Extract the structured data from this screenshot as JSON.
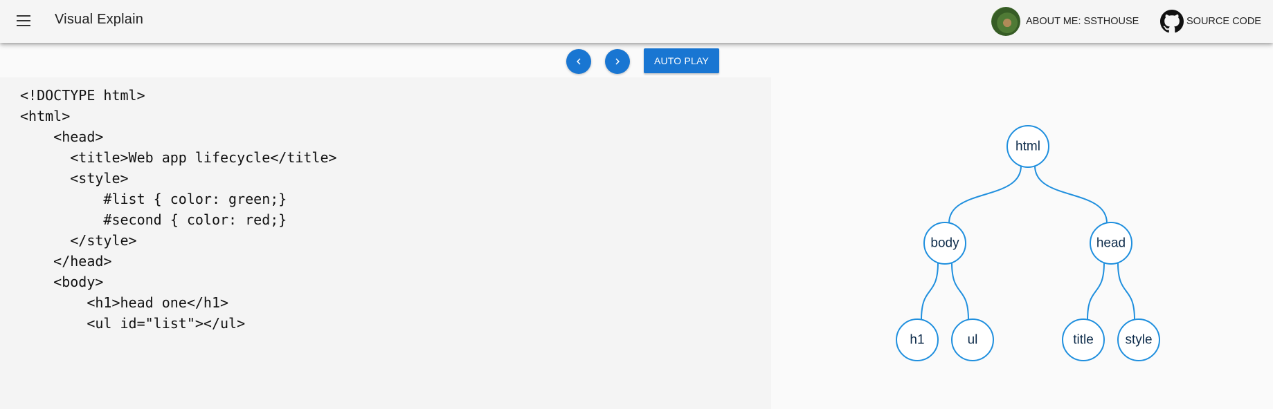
{
  "app": {
    "title": "Visual Explain",
    "nav": {
      "about_label": "ABOUT ME: SSTHOUSE",
      "source_label": "SOURCE CODE"
    }
  },
  "controls": {
    "prev_icon": "chevron-left-icon",
    "next_icon": "chevron-right-icon",
    "autoplay_label": "AUTO PLAY"
  },
  "code": {
    "lines": [
      "<!DOCTYPE html>",
      "<html>",
      "    <head>",
      "      <title>Web app lifecycle</title>",
      "      <style>",
      "          #list { color: green;}",
      "          #second { color: red;}",
      "      </style>",
      "    </head>",
      "    <body>",
      "        <h1>head one</h1>",
      "        <ul id=\"list\"></ul>"
    ]
  },
  "tree": {
    "nodes": [
      {
        "id": "html",
        "label": "html",
        "parent": null
      },
      {
        "id": "body",
        "label": "body",
        "parent": "html"
      },
      {
        "id": "head",
        "label": "head",
        "parent": "html"
      },
      {
        "id": "h1",
        "label": "h1",
        "parent": "body"
      },
      {
        "id": "ul",
        "label": "ul",
        "parent": "body"
      },
      {
        "id": "title",
        "label": "title",
        "parent": "head"
      },
      {
        "id": "style",
        "label": "style",
        "parent": "head"
      }
    ]
  },
  "colors": {
    "accent": "#1976d2",
    "tree_stroke": "#1f8fde"
  }
}
